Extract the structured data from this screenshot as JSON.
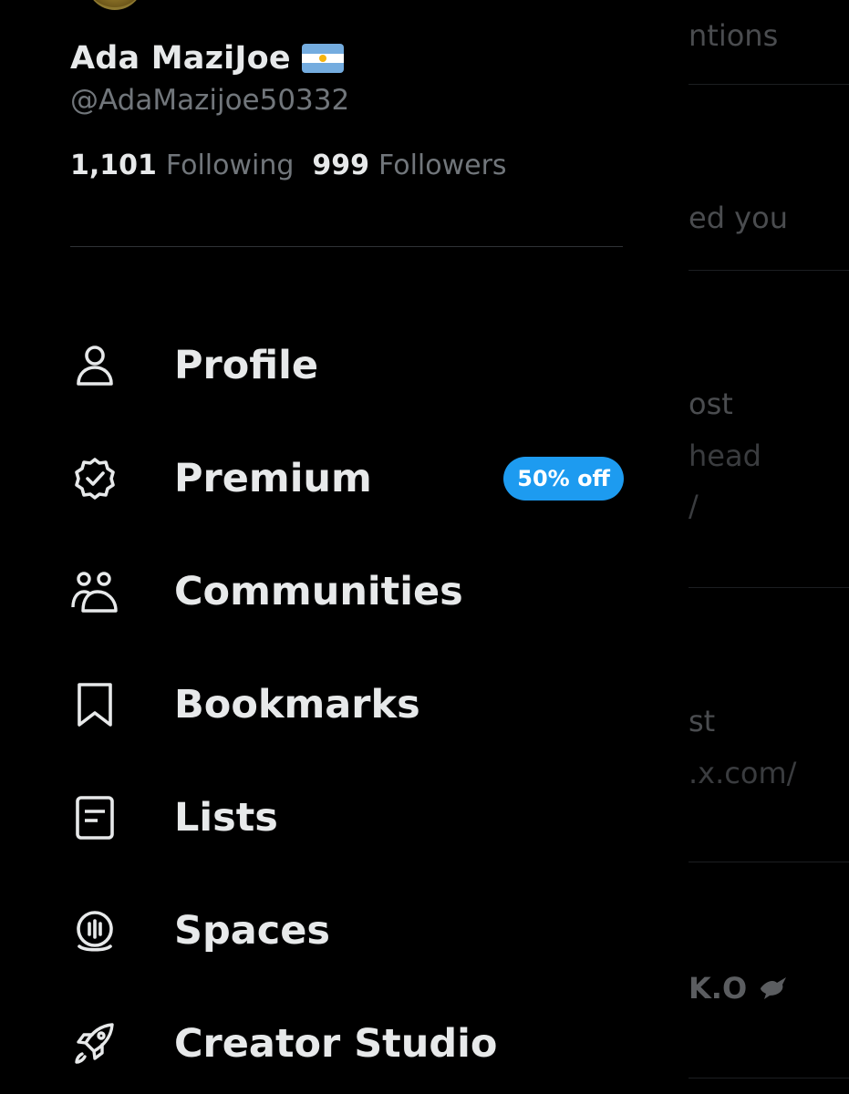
{
  "background_feed": {
    "fragments": [
      "ntions",
      "ed you",
      "ost",
      "head",
      "/",
      "st",
      ".x.com/",
      "K.O"
    ]
  },
  "profile": {
    "display_name": "Ada MaziJoe",
    "flag_emoji_icon": "argentina-flag-icon",
    "handle": "@AdaMazijoe50332",
    "following_count": "1,101",
    "following_label": "Following",
    "followers_count": "999",
    "followers_label": "Followers"
  },
  "menu": {
    "items": [
      {
        "label": "Profile",
        "icon": "person-icon"
      },
      {
        "label": "Premium",
        "icon": "verified-badge-icon",
        "badge": "50% off"
      },
      {
        "label": "Communities",
        "icon": "people-icon"
      },
      {
        "label": "Bookmarks",
        "icon": "bookmark-icon"
      },
      {
        "label": "Lists",
        "icon": "list-icon"
      },
      {
        "label": "Spaces",
        "icon": "microphone-icon"
      },
      {
        "label": "Creator Studio",
        "icon": "rocket-icon"
      }
    ]
  },
  "colors": {
    "background": "#000000",
    "text_primary": "#e7e9ea",
    "text_secondary": "#71767b",
    "accent": "#1d9bf0",
    "divider": "#2f3336"
  }
}
